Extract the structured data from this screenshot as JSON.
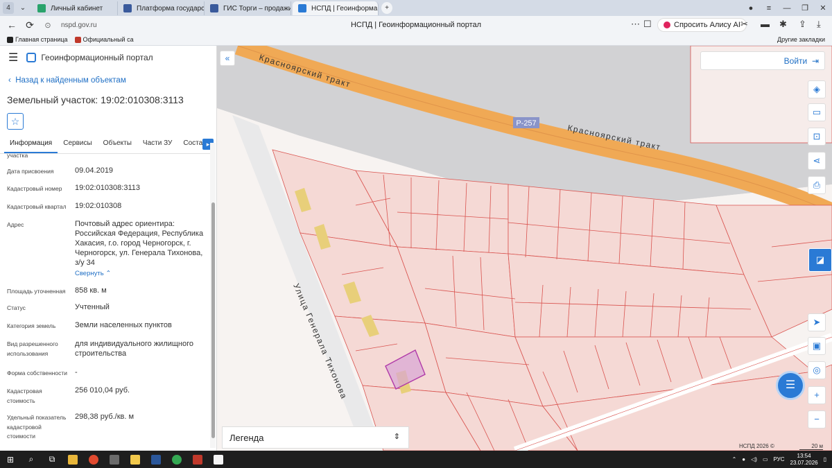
{
  "browser": {
    "tab_counter": "4",
    "tabs": [
      {
        "title": "Личный кабинет",
        "icon": "cabinet-icon",
        "color": "#2aa36c"
      },
      {
        "title": "Платформа государственн",
        "icon": "gov-emblem-icon",
        "color": "#3a5a9c"
      },
      {
        "title": "ГИС Торги – продажи гос",
        "icon": "gov-emblem-icon",
        "color": "#3a5a9c"
      },
      {
        "title": "НСПД | Геоинформаци",
        "icon": "nspd-icon",
        "color": "#2a7ad5",
        "active": true
      }
    ],
    "url": "nspd.gov.ru",
    "page_title": "НСПД | Геоинформационный портал",
    "alice_button": "Спросить Алису AI",
    "bookmarks": [
      {
        "label": "Главная страница",
        "color": "#222"
      },
      {
        "label": "Официальный са",
        "color": "#c0392b"
      }
    ],
    "other_bookmarks": "Другие закладки"
  },
  "portal": {
    "title": "Геоинформационный портал",
    "back_link": "Назад к найденным объектам",
    "object_title": "Земельный участок: 19:02:010308:3113",
    "tabs": [
      "Информация",
      "Сервисы",
      "Объекты",
      "Части ЗУ",
      "Состав"
    ],
    "rows": [
      {
        "label": "участка",
        "value": ""
      },
      {
        "label": "Дата присвоения",
        "value": "09.04.2019"
      },
      {
        "label": "Кадастровый номер",
        "value": "19:02:010308:3113"
      },
      {
        "label": "Кадастровый квартал",
        "value": "19:02:010308"
      },
      {
        "label": "Адрес",
        "value": "Почтовый адрес ориентира: Российская Федерация, Республика Хакасия, г.о. город Черногорск, г. Черногорск, ул. Генерала Тихонова, з/у 34",
        "link": "Свернуть"
      },
      {
        "label": "Площадь уточненная",
        "value": "858 кв. м"
      },
      {
        "label": "Статус",
        "value": "Учтенный"
      },
      {
        "label": "Категория земель",
        "value": "Земли населенных пунктов"
      },
      {
        "label": "Вид разрешенного использования",
        "value": "для индивидуального жилищного строительства"
      },
      {
        "label": "Форма собственности",
        "value": "-"
      },
      {
        "label": "Кадастровая стоимость",
        "value": "256 010,04 руб."
      },
      {
        "label": "Удельный показатель кадастровой стоимости",
        "value": "298,38 руб./кв. м"
      }
    ]
  },
  "map": {
    "road_name_1": "Красноярский тракт",
    "road_name_2": "Красноярский тракт",
    "road_badge": "Р-257",
    "street_name": "Улица Генерала Тихонова",
    "login": "Войти",
    "legend": "Легенда",
    "attribution": "НСПД 2026 ©",
    "scale": "20 м",
    "colors": {
      "road": "#f0a955",
      "parcel_line": "#d9534f",
      "selected": "#b03aa8",
      "building": "#e8cf7a"
    }
  },
  "taskbar": {
    "lang": "РУС",
    "time": "13:54",
    "date": "23.07.2026"
  }
}
